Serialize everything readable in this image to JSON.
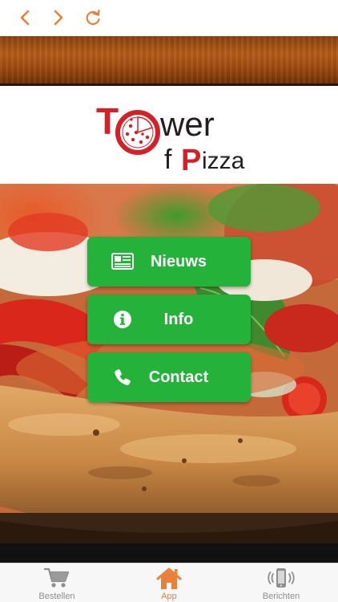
{
  "nav": {
    "back_icon": "chevron-left-icon",
    "forward_icon": "chevron-right-icon",
    "reload_icon": "refresh-icon",
    "accent_color": "#e9803a"
  },
  "logo": {
    "line1_first": "T",
    "line1_rest": "wer",
    "line2_first": "f",
    "line2_accent": "P",
    "line2_rest": "izza",
    "colors": {
      "red": "#d42027",
      "dark": "#231f20"
    }
  },
  "menu": {
    "button_color": "#25b23b",
    "items": [
      {
        "label": "Nieuws",
        "icon": "newspaper-icon"
      },
      {
        "label": "Info",
        "icon": "info-icon"
      },
      {
        "label": "Contact",
        "icon": "phone-icon"
      }
    ]
  },
  "tabbar": {
    "active_color": "#e9803a",
    "inactive_color": "#8e8e8e",
    "tabs": [
      {
        "label": "Bestellen",
        "icon": "cart-icon",
        "active": false
      },
      {
        "label": "App",
        "icon": "home-icon",
        "active": true
      },
      {
        "label": "Berichten",
        "icon": "phone-vibrate-icon",
        "active": false
      }
    ]
  }
}
